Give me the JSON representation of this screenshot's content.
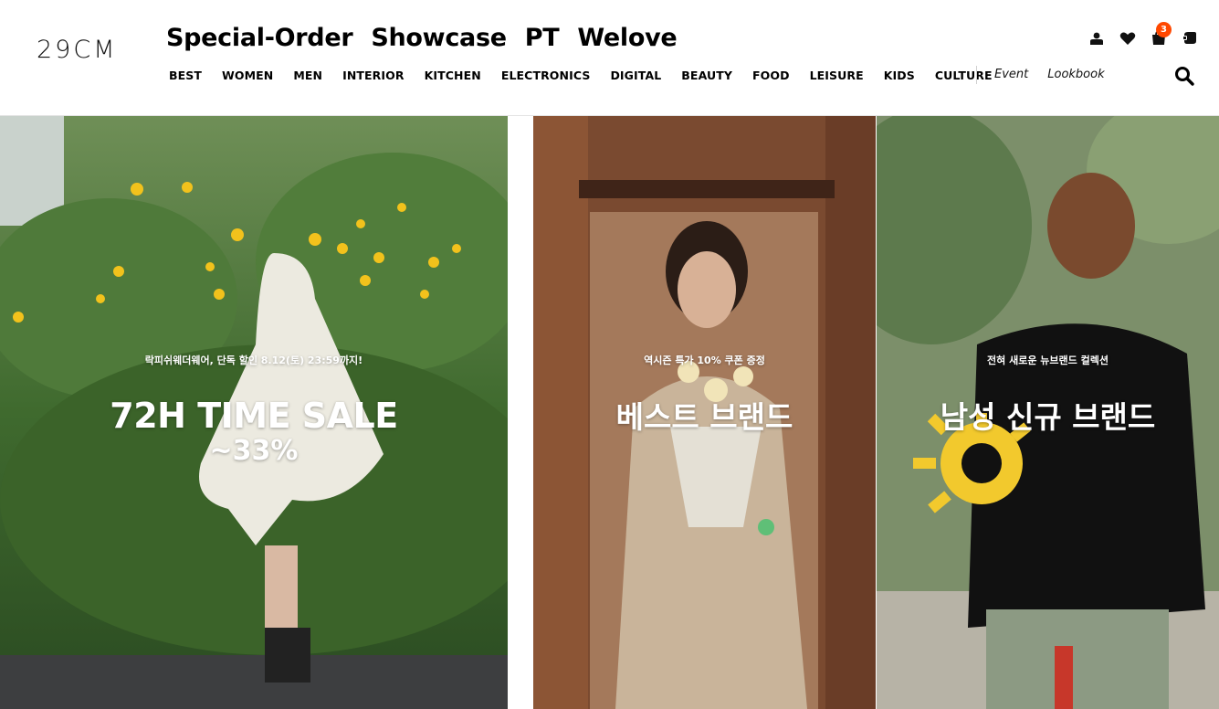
{
  "logo": "29CM",
  "top_nav": [
    "Special-Order",
    "Showcase",
    "PT",
    "Welove"
  ],
  "categories": [
    "BEST",
    "WOMEN",
    "MEN",
    "INTERIOR",
    "KITCHEN",
    "ELECTRONICS",
    "DIGITAL",
    "BEAUTY",
    "FOOD",
    "LEISURE",
    "KIDS",
    "CULTURE"
  ],
  "extra_nav": [
    "Event",
    "Lookbook"
  ],
  "header_icons": [
    "user-icon",
    "heart-icon",
    "cart-icon",
    "chat-icon",
    "search-icon"
  ],
  "cart_count": "3",
  "colors": {
    "badge": "#ff4800",
    "text": "#000000",
    "border": "#e4e4e4"
  },
  "banners": [
    {
      "sub": "락피쉬웨더웨어, 단독 할인 8.12(토) 23:59까지!",
      "title": "72H TIME SALE",
      "extra": "~33%"
    },
    {
      "sub": "역시즌 특가 10% 쿠폰 증정",
      "title": "베스트 브랜드"
    },
    {
      "sub": "전혀 새로운 뉴브랜드 컬렉션",
      "title": "남성 신규 브랜드"
    }
  ]
}
